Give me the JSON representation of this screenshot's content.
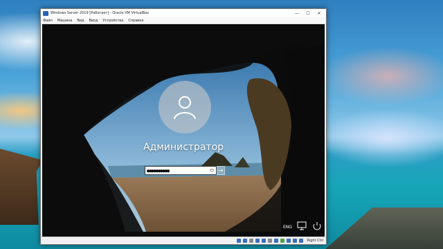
{
  "window": {
    "title": "Windows Server 2019 [Работает] - Oracle VM VirtualBox",
    "minimize_glyph": "—",
    "maximize_glyph": "☐",
    "close_glyph": "✕"
  },
  "menu": {
    "items": [
      {
        "label": "Файл"
      },
      {
        "label": "Машина"
      },
      {
        "label": "Вид"
      },
      {
        "label": "Ввод"
      },
      {
        "label": "Устройства"
      },
      {
        "label": "Справка"
      }
    ]
  },
  "login": {
    "username": "Администратор",
    "password_value": "●●●●●●●●●●",
    "submit_glyph": "→"
  },
  "tray": {
    "language": "ENG"
  },
  "statusbar": {
    "host_key": "Right Ctrl"
  },
  "colors": {
    "accent": "#2b62b3",
    "status_green": "#4aa84a"
  }
}
